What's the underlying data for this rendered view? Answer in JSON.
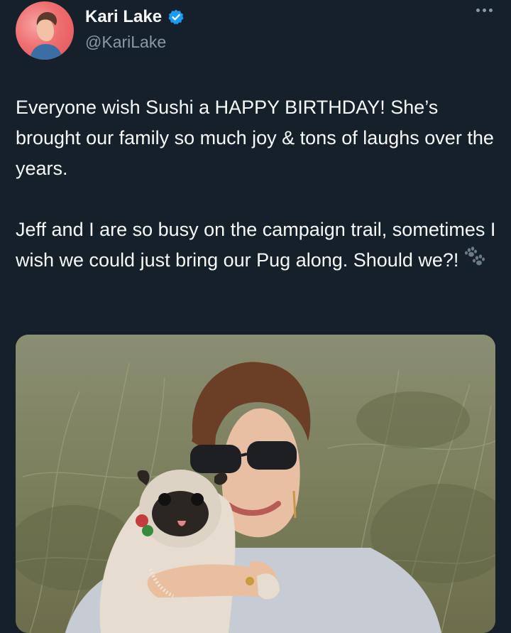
{
  "author": {
    "display_name": "Kari Lake",
    "handle": "@KariLake",
    "verified": true,
    "avatar_icon": "profile-avatar"
  },
  "menu": {
    "icon": "more-horizontal-icon"
  },
  "tweet": {
    "paragraph_1": "Everyone wish Sushi a HAPPY BIRTHDAY! She’s brought our family so much joy & tons of laughs over the years.",
    "paragraph_2": "Jeff and I are so busy on the campaign trail, sometimes I wish we could just bring our Pug along. Should we?!",
    "emoji": "paw-prints-emoji"
  },
  "media": {
    "type": "photo"
  },
  "colors": {
    "background": "#15202b",
    "text": "#f7f9f9",
    "muted": "#8b98a5",
    "verified": "#1d9bf0"
  }
}
